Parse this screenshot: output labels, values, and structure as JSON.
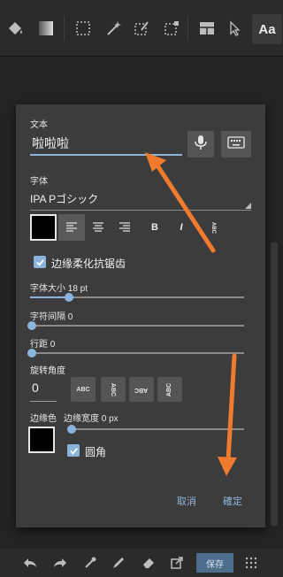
{
  "toolbar": {
    "icons": [
      "paint-bucket-icon",
      "gradient-icon",
      "rect-select-icon",
      "magic-wand-icon",
      "lasso-edit-icon",
      "select-transform-icon",
      "layout-icon",
      "pointer-icon"
    ],
    "text_tool_label": "Aa"
  },
  "dialog": {
    "text_label": "文本",
    "text_value": "啦啦啦",
    "font_label": "字体",
    "font_value": "IPA Pゴシック",
    "text_color": "#000000",
    "style_bold": "B",
    "style_italic": "I",
    "style_vertical": "ABC",
    "antialias_label": "边缘柔化抗锯齿",
    "antialias_checked": true,
    "font_size_label": "字体大小  18  pt",
    "font_size_value": 18,
    "letter_spacing_label": "字符间隔  0",
    "letter_spacing_value": 0,
    "line_spacing_label": "行距  0",
    "line_spacing_value": 0,
    "rotation_label": "旋转角度",
    "rotation_value": "0",
    "rotation_buttons": [
      "ABC",
      "ABC",
      "ABC",
      "ABC"
    ],
    "border_color_label": "边缘色",
    "border_color": "#000000",
    "border_width_label": "边缘宽度  0  px",
    "border_width_value": 0,
    "rounded_label": "圆角",
    "rounded_checked": true,
    "cancel_label": "取消",
    "confirm_label": "確定"
  },
  "bottombar": {
    "icons": [
      "undo-icon",
      "redo-icon",
      "eyedropper-icon",
      "pen-icon",
      "eraser-icon",
      "export-icon"
    ],
    "save_label": "保存",
    "grid_icon": "grid-dots-icon"
  },
  "colors": {
    "accent": "#8ab4dc",
    "annotation_arrow": "#f07a2e"
  }
}
